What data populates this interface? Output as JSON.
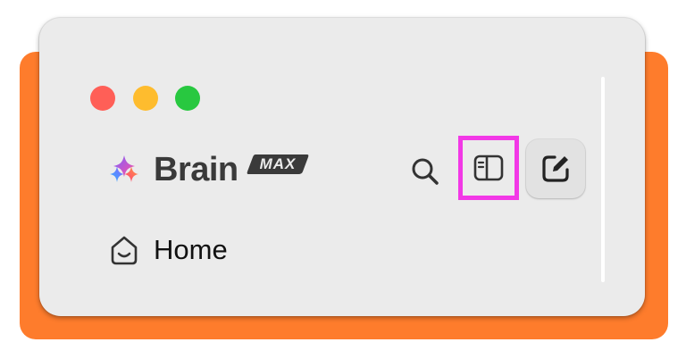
{
  "window": {
    "traffic_lights": [
      {
        "name": "close",
        "color": "#ff5f57"
      },
      {
        "name": "minimize",
        "color": "#febc2e"
      },
      {
        "name": "zoom",
        "color": "#28c840"
      }
    ]
  },
  "header": {
    "brand_name": "Brain",
    "badge_text": "MAX",
    "logo_icon": "sparkle-logo-icon",
    "actions": [
      {
        "icon": "search-icon"
      },
      {
        "icon": "sidebar-toggle-icon",
        "highlight_color": "#f238e6"
      },
      {
        "icon": "compose-icon"
      }
    ]
  },
  "nav": {
    "items": [
      {
        "label": "Home",
        "icon": "home-icon"
      }
    ]
  },
  "colors": {
    "backdrop": "#fe7c2c",
    "window": "#ebebeb",
    "highlight": "#f238e6"
  }
}
